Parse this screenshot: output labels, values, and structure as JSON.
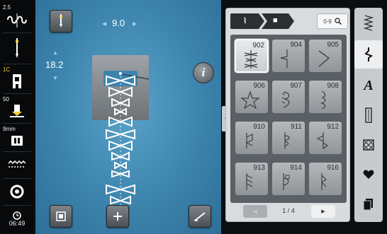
{
  "status_bar": {
    "stitch_width": "2.5",
    "presser_foot_code": "1C",
    "presser_pressure": "50",
    "machine_mm": "9mm",
    "time": "06:49"
  },
  "stitch_area": {
    "width_value": "9.0",
    "length_value": "18.2"
  },
  "panel": {
    "search_code": "0-9",
    "stitches": [
      {
        "number": "902",
        "selected": true
      },
      {
        "number": "904",
        "selected": false
      },
      {
        "number": "905",
        "selected": false
      },
      {
        "number": "906",
        "selected": false
      },
      {
        "number": "907",
        "selected": false
      },
      {
        "number": "908",
        "selected": false
      },
      {
        "number": "910",
        "selected": false
      },
      {
        "number": "911",
        "selected": false
      },
      {
        "number": "912",
        "selected": false
      },
      {
        "number": "913",
        "selected": false
      },
      {
        "number": "914",
        "selected": false
      },
      {
        "number": "916",
        "selected": false
      }
    ],
    "page_indicator": "1 / 4"
  },
  "category_bar": {
    "active_index": 1,
    "items": [
      "decorative-stitch-icon",
      "stitch-icon",
      "alphabet-icon",
      "buttonhole-icon",
      "quilt-icon",
      "heart-icon",
      "file-icon"
    ]
  },
  "colors": {
    "main_background": "#3c84ad",
    "accent_yellow": "#f3d23a"
  }
}
